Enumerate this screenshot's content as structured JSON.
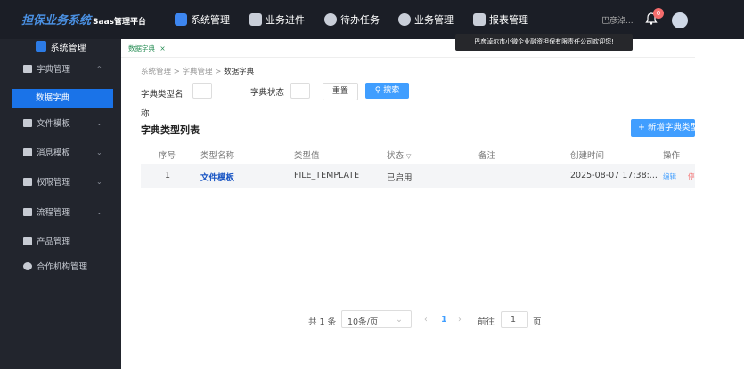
{
  "app": {
    "title": "担保业务系统",
    "subtitle": "Saas管理平台"
  },
  "topnav": [
    {
      "label": "系统管理",
      "icon": "system-icon"
    },
    {
      "label": "业务进件",
      "icon": "document-icon"
    },
    {
      "label": "待办任务",
      "icon": "clock-icon"
    },
    {
      "label": "业务管理",
      "icon": "clock-icon"
    },
    {
      "label": "报表管理",
      "icon": "bar-chart-icon"
    }
  ],
  "user": {
    "name": "巴彦淖...",
    "notifications": "0"
  },
  "tooltip": "巴彦淖尔市小微企业融资担保有限责任公司欢迎您!",
  "sidebar": {
    "header": "系统管理",
    "items": [
      {
        "label": "字典管理",
        "icon": "book-icon"
      },
      {
        "label": "数据字典",
        "icon": ""
      },
      {
        "label": "文件模板",
        "icon": "folder-icon"
      },
      {
        "label": "消息模板",
        "icon": "message-icon"
      },
      {
        "label": "权限管理",
        "icon": "key-icon"
      },
      {
        "label": "流程管理",
        "icon": "flow-icon"
      },
      {
        "label": "产品管理",
        "icon": "grid-icon"
      },
      {
        "label": "合作机构管理",
        "icon": "org-icon"
      }
    ]
  },
  "tabs": [
    {
      "label": "数据字典",
      "close": "×"
    }
  ],
  "breadcrumb": {
    "items": [
      "系统管理",
      "字典管理"
    ],
    "current": "数据字典",
    "sep": ">"
  },
  "filters": {
    "type_name_label": "字典类型名称",
    "status_label": "字典状态",
    "reset": "重置",
    "search": "搜索"
  },
  "table": {
    "title": "字典类型列表",
    "add_button": "+ 新增字典类型",
    "columns": [
      "序号",
      "类型名称",
      "类型值",
      "状态",
      "备注",
      "创建时间",
      "操作"
    ],
    "rows": [
      {
        "index": "1",
        "name": "文件模板",
        "value": "FILE_TEMPLATE",
        "status": "已启用",
        "remark": "",
        "created": "2025-08-07 17:38:...",
        "edit": "编辑",
        "more": "停"
      }
    ]
  },
  "pagination": {
    "total": "共 1 条",
    "page_size": "10条/页",
    "prev": "‹",
    "page": "1",
    "next": "›",
    "goto": "前往",
    "goto_value": "1",
    "page_unit": "页"
  }
}
